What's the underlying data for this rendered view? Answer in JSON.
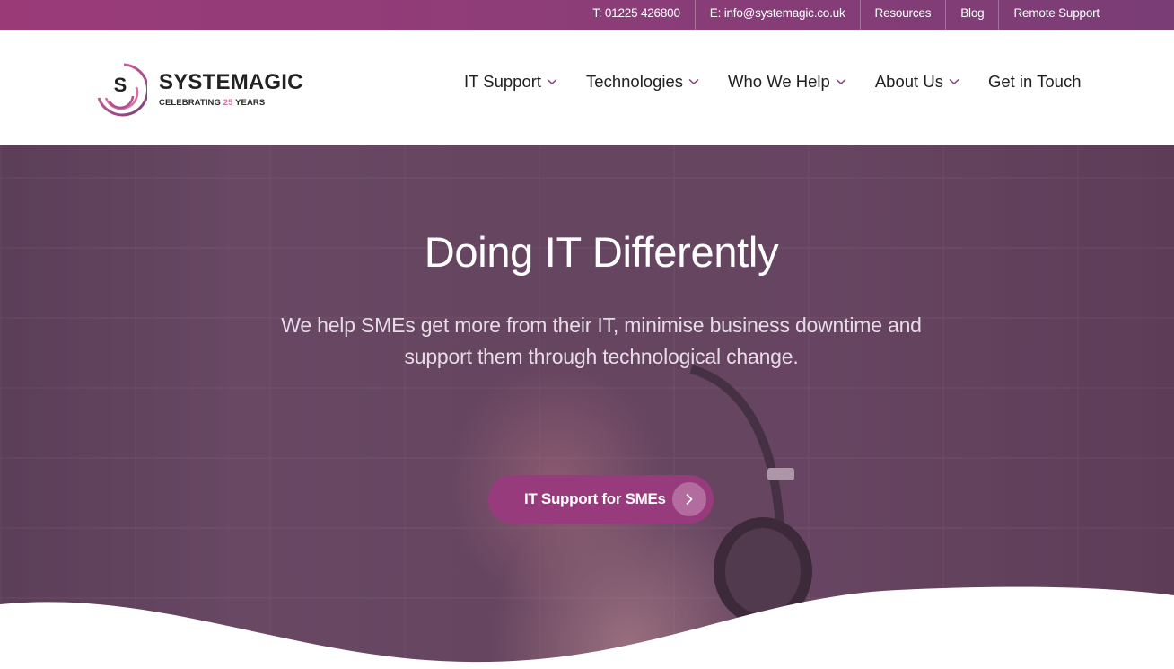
{
  "topbar": {
    "phone": "T: 01225 426800",
    "email": "E: info@systemagic.co.uk",
    "links": [
      "Resources",
      "Blog",
      "Remote Support"
    ]
  },
  "brand": {
    "name": "SYSTEMAGIC",
    "logo_letter": "S",
    "tagline_prefix": "CELEBRATING ",
    "tagline_number": "25",
    "tagline_suffix": " YEARS",
    "accent_color": "#983b7c",
    "highlight_color": "#e06aa5"
  },
  "nav": {
    "items": [
      {
        "label": "IT Support",
        "has_dropdown": true
      },
      {
        "label": "Technologies",
        "has_dropdown": true
      },
      {
        "label": "Who We Help",
        "has_dropdown": true
      },
      {
        "label": "About Us",
        "has_dropdown": true
      },
      {
        "label": "Get in Touch",
        "has_dropdown": false
      }
    ]
  },
  "hero": {
    "title": "Doing IT Differently",
    "subtitle": "We help SMEs get more from their IT, minimise business downtime and support them through technological change.",
    "cta_label": "IT Support for SMEs",
    "cta_icon": "chevron-right-icon"
  }
}
